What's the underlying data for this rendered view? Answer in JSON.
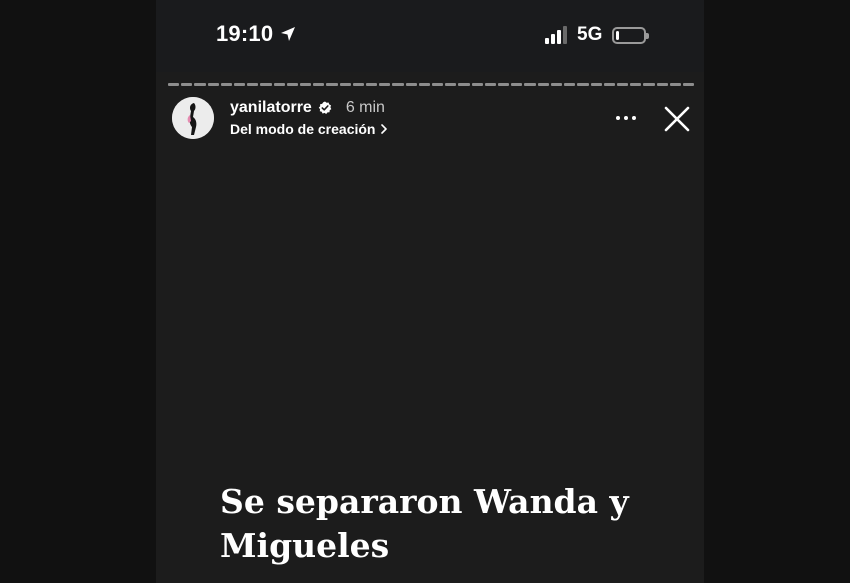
{
  "status_bar": {
    "time": "19:10",
    "network": "5G",
    "signal_bars": 3,
    "signal_max": 4,
    "battery_level": 0.12,
    "icons": [
      "location-arrow-icon",
      "signal-icon",
      "battery-icon"
    ]
  },
  "story": {
    "progress_segments": 40,
    "user": {
      "username": "yanilatorre",
      "verified": true,
      "time_ago": "6 min",
      "subtitle": "Del modo de creación"
    },
    "headline": "Se separaron Wanda y Migueles"
  },
  "colors": {
    "background": "#1c1c1c",
    "outer": "#111111",
    "text": "#ffffff",
    "muted": "#c8c8c8",
    "verified_badge": "#ffffff"
  }
}
